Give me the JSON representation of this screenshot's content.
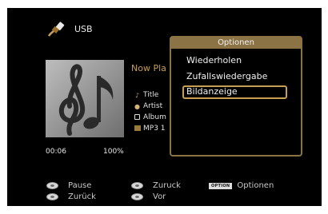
{
  "header": {
    "source_icon": "usb-cable-icon",
    "source_label": "USB"
  },
  "album_art": {
    "icon": "music-notes-treble-clef-icon"
  },
  "now_playing": {
    "heading": "Now Pla",
    "title_label": "Title",
    "artist_label": "Artist",
    "album_label": "Album",
    "format_label": "MP3 1",
    "elapsed": "00:06",
    "progress": "100%"
  },
  "footer": {
    "pause_label": "Pause",
    "back_label": "Zurück",
    "skip_back_label": "Zuruck",
    "forward_label": "Vor",
    "option_badge": "OPTION",
    "options_label": "Optionen"
  },
  "menu": {
    "title": "Optionen",
    "items": [
      "Wiederholen",
      "Zufallswiedergabe",
      "Bildanzeige"
    ],
    "selected_index": 2
  },
  "colors": {
    "accent": "#c69f52",
    "menu_border": "#8c7346",
    "background": "#000000"
  }
}
